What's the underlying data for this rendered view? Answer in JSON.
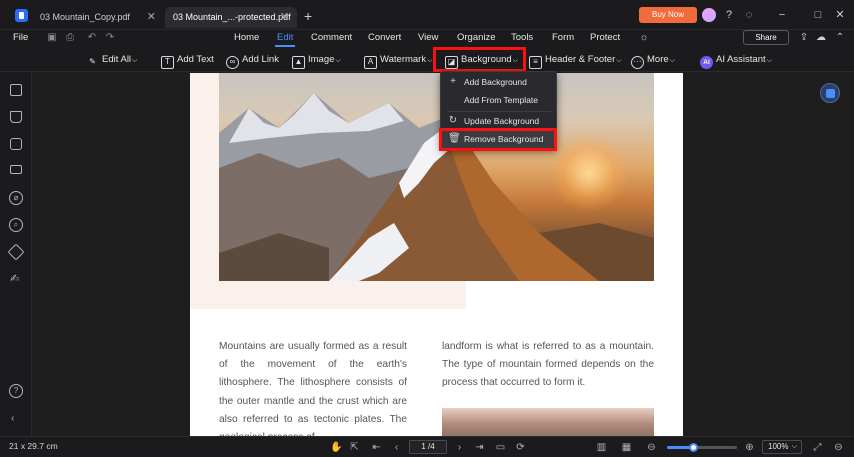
{
  "tabs": [
    {
      "label": "03 Mountain_Copy.pdf",
      "close": "✕"
    },
    {
      "label": "03 Mountain_...-protected.pdf",
      "close": "✕"
    }
  ],
  "titlebar": {
    "new_tab": "+",
    "buy_now": "Buy Now",
    "icons": [
      "avatar",
      "help-icon",
      "notification-icon",
      "minimize-icon",
      "maximize-icon",
      "close-icon"
    ]
  },
  "menubar": {
    "file": "File",
    "items": [
      "Home",
      "Edit",
      "Comment",
      "Convert",
      "View",
      "Organize",
      "Tools",
      "Form",
      "Protect"
    ],
    "active": "Edit",
    "share": "Share"
  },
  "toolbar": {
    "edit_all": "Edit All",
    "add_text": "Add Text",
    "add_link": "Add Link",
    "image": "Image",
    "watermark": "Watermark",
    "background": "Background",
    "header_footer": "Header & Footer",
    "more": "More",
    "ai_badge": "AI",
    "ai_assistant": "AI Assistant"
  },
  "dropdown": {
    "items": [
      {
        "label": "Add Background",
        "icon": "plus-icon"
      },
      {
        "label": "Add From Template",
        "icon": "blank-icon"
      },
      {
        "label": "Update Background",
        "icon": "refresh-icon"
      },
      {
        "label": "Remove Background",
        "icon": "trash-icon"
      }
    ]
  },
  "document": {
    "col_left": "Mountains are usually formed as a result of the movement of the earth's lithosphere. The lithosphere consists of the outer mantle and the crust which are also referred to as tectonic plates. The geological process of",
    "col_right": "landform is what is referred to as a mountain. The type of mountain formed depends on the process that occurred to form it."
  },
  "statusbar": {
    "page_size": "21 x 29.7 cm",
    "page_indicator": "1 /4",
    "zoom": "100%",
    "zoom_level": 0.38
  },
  "colors": {
    "accent": "#4a8dff",
    "highlight": "#ff1010",
    "buy_button": "#f36a3d"
  }
}
